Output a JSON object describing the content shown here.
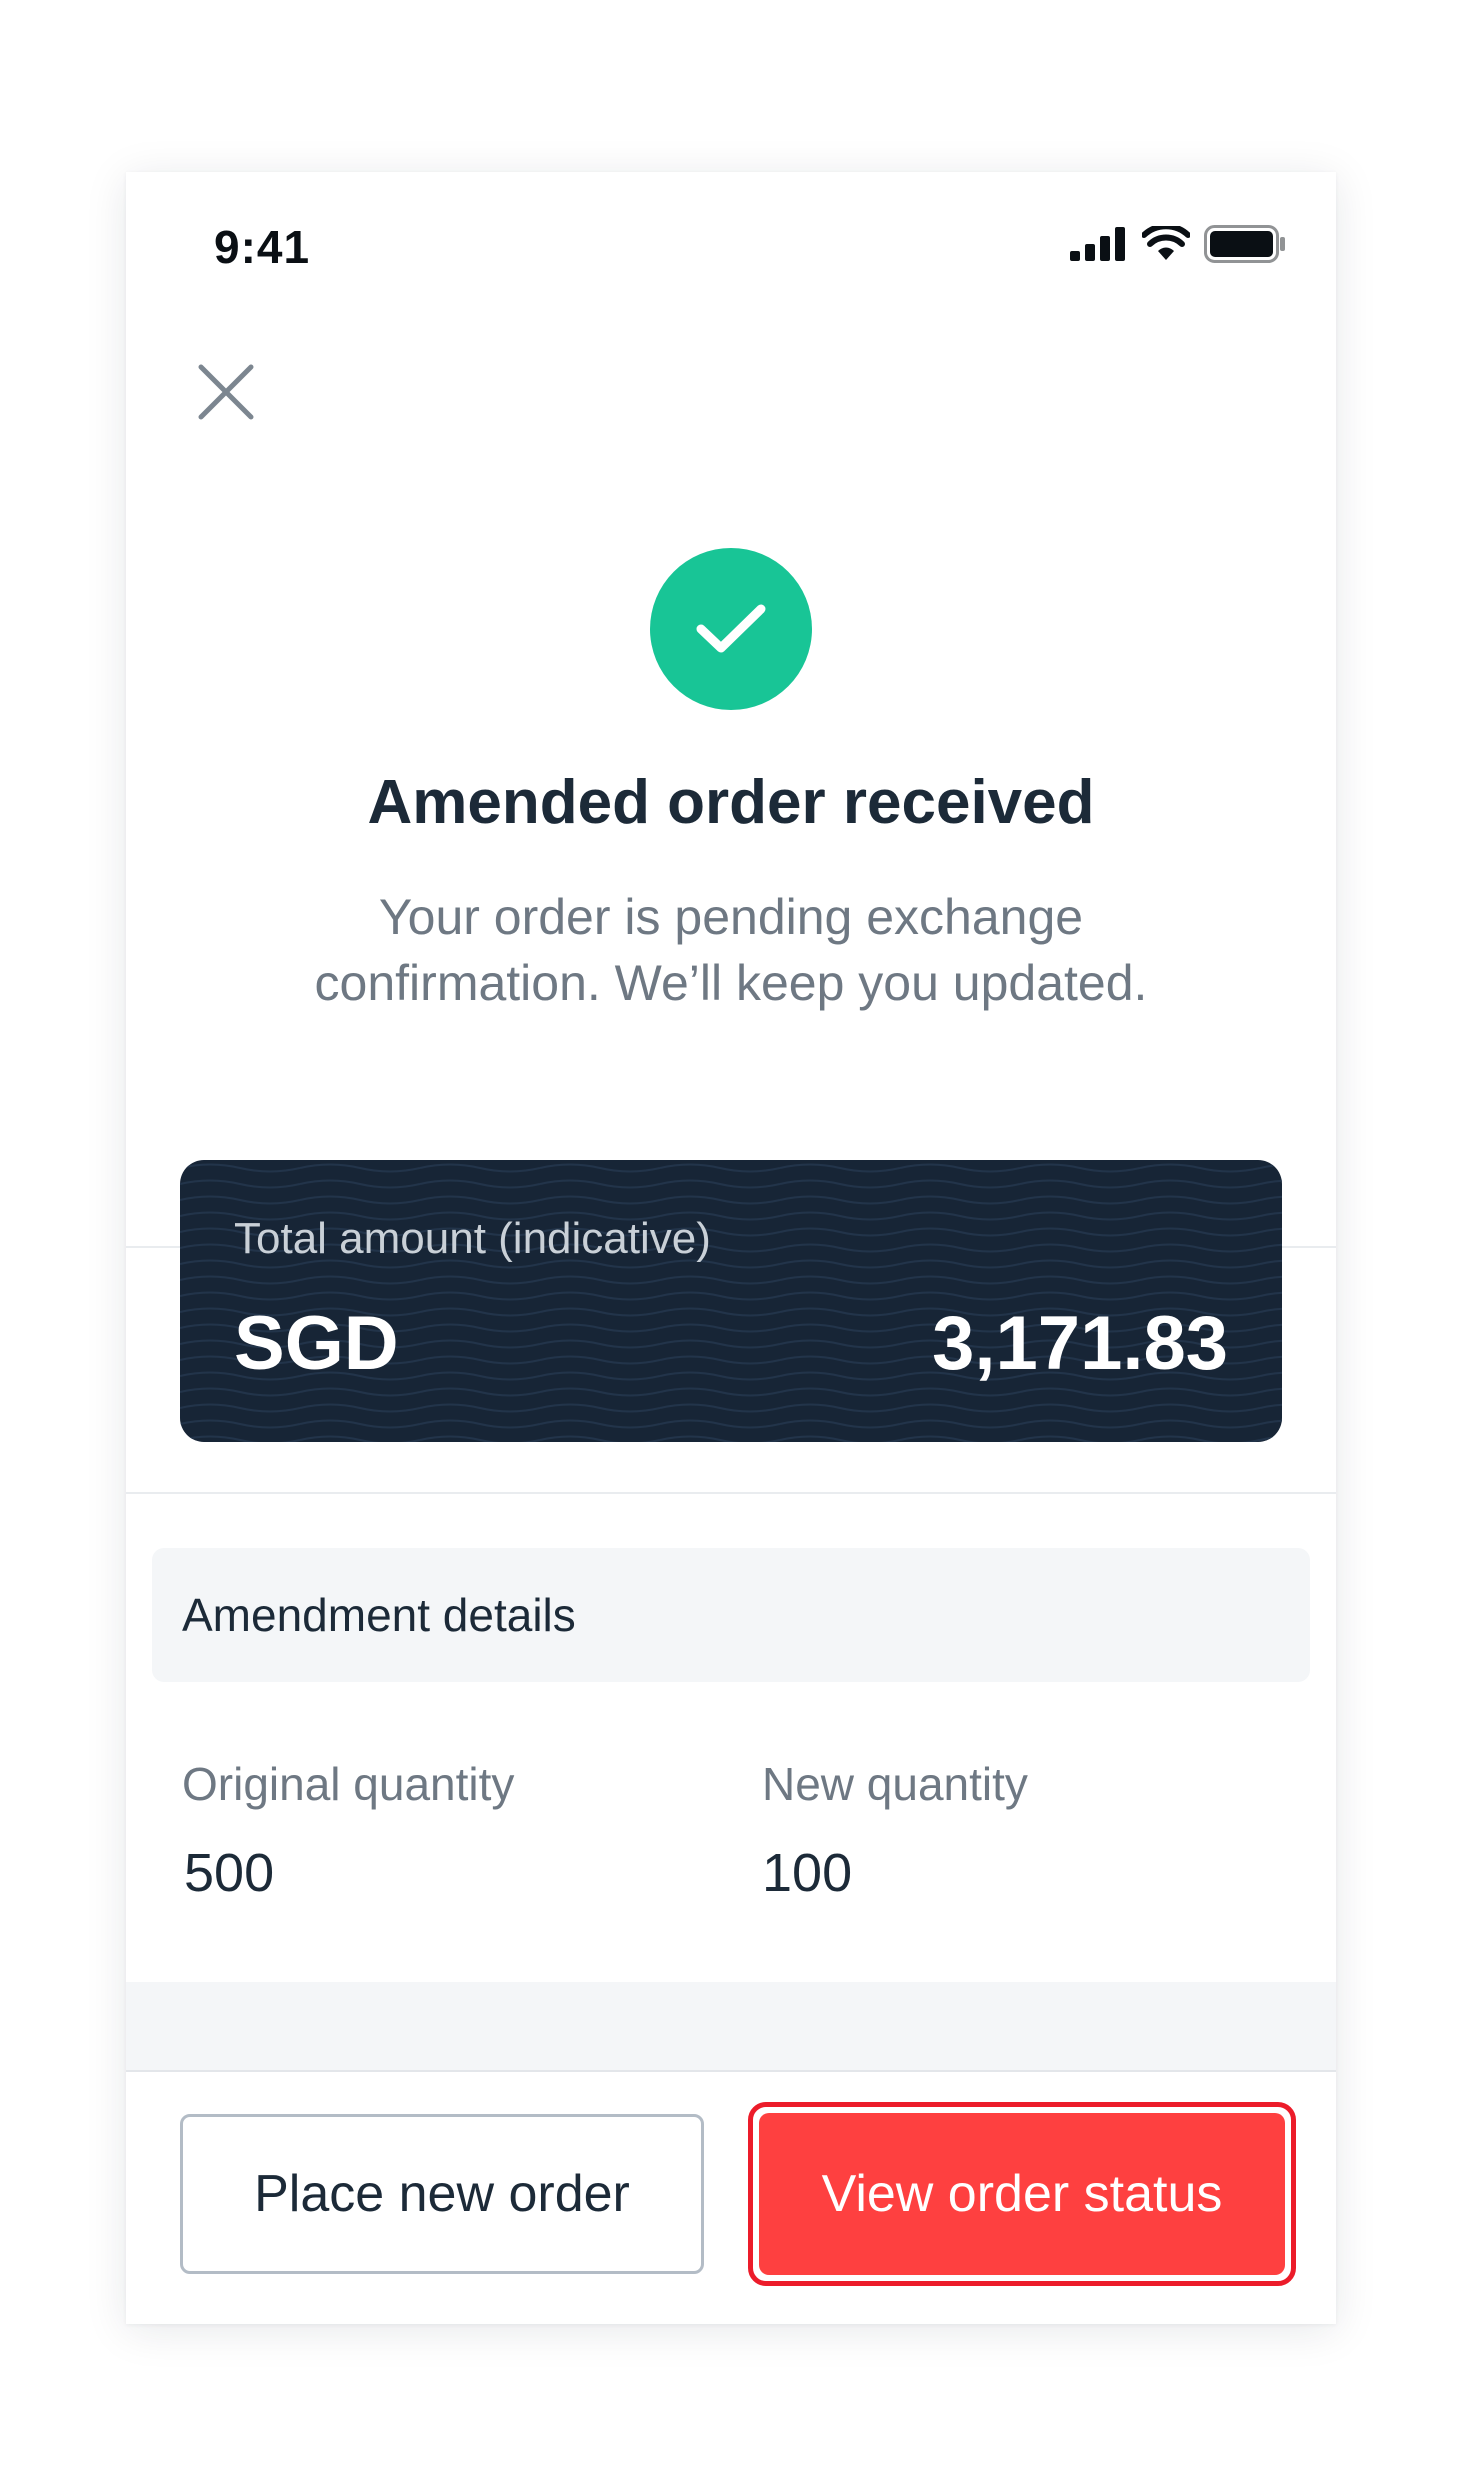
{
  "status_bar": {
    "time": "9:41",
    "icons": [
      "cellular-signal-icon",
      "wifi-icon",
      "battery-icon"
    ]
  },
  "header": {
    "close_icon": "close-icon"
  },
  "confirmation": {
    "icon": "check-circle-icon",
    "title": "Amended order received",
    "message": "Your order is pending exchange confirmation. We’ll keep you updated."
  },
  "amount_card": {
    "label": "Total amount (indicative)",
    "currency": "SGD",
    "value": "3,171.83"
  },
  "amendment": {
    "section_title": "Amendment details",
    "original_label": "Original quantity",
    "original_value": "500",
    "new_label": "New quantity",
    "new_value": "100"
  },
  "actions": {
    "secondary_label": "Place new order",
    "primary_label": "View order status"
  },
  "colors": {
    "success": "#18c596",
    "card_background": "#172536",
    "primary_button": "#fe4040",
    "highlight_outline": "#ec1c2a"
  }
}
